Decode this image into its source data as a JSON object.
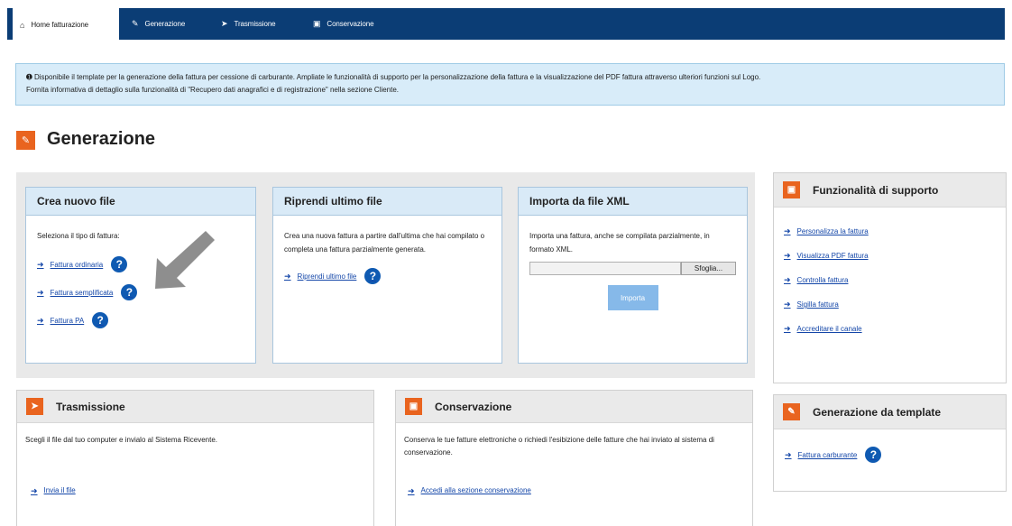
{
  "nav": {
    "tabs": [
      {
        "label": "Home fatturazione",
        "icon": "home-icon"
      },
      {
        "label": "Generazione",
        "icon": "pencil-icon"
      },
      {
        "label": "Trasmissione",
        "icon": "paper-plane-icon"
      },
      {
        "label": "Conservazione",
        "icon": "archive-icon"
      }
    ]
  },
  "info": {
    "line1": "Disponibile il template per la generazione della fattura per cessione di carburante. Ampliate le funzionalità di supporto per la personalizzazione della fattura e la visualizzazione del PDF fattura attraverso ulteriori funzioni sul Logo.",
    "line2": "Fornita informativa di dettaglio sulla funzionalità di \"Recupero dati anagrafici e di registrazione\" nella sezione Cliente."
  },
  "page_title": "Generazione",
  "crea": {
    "title": "Crea nuovo file",
    "prompt": "Seleziona il tipo di fattura:",
    "links": [
      "Fattura ordinaria",
      "Fattura semplificata",
      "Fattura PA"
    ]
  },
  "riprendi": {
    "title": "Riprendi ultimo file",
    "text": "Crea una nuova fattura a partire dall'ultima che hai compilato o completa una fattura parzialmente generata.",
    "link": "Riprendi ultimo file"
  },
  "importa": {
    "title": "Importa da file XML",
    "text": "Importa una fattura, anche se compilata parzialmente, in formato XML.",
    "browse": "Sfoglia...",
    "button": "Importa"
  },
  "funzionalita": {
    "title": "Funzionalità di supporto",
    "links": [
      "Personalizza la fattura",
      "Visualizza PDF fattura",
      "Controlla fattura",
      "Sigilla fattura",
      "Accreditare il canale"
    ]
  },
  "trasmissione": {
    "title": "Trasmissione",
    "text": "Scegli il file dal tuo computer e invialo al Sistema Ricevente.",
    "link": "Invia il file"
  },
  "conservazione": {
    "title": "Conservazione",
    "text": "Conserva le tue fatture elettroniche o richiedi l'esibizione delle fatture che hai inviato al sistema di conservazione.",
    "link": "Accedi alla sezione conservazione"
  },
  "template": {
    "title": "Generazione da template",
    "link": "Fattura carburante"
  },
  "colors": {
    "nav": "#0b3d75",
    "accent": "#e9641f",
    "link": "#1346a8",
    "info_bg": "#d8ecf9"
  }
}
